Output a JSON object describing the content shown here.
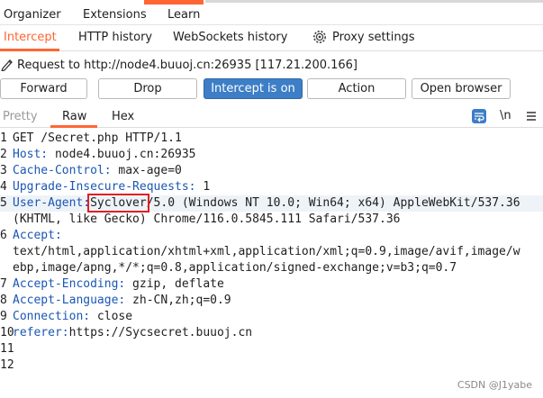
{
  "top_menu": {
    "items": [
      "Organizer",
      "Extensions",
      "Learn"
    ]
  },
  "proxy_tabs": {
    "tabs": [
      "Intercept",
      "HTTP history",
      "WebSockets history",
      "Proxy settings"
    ]
  },
  "request": {
    "text": "Request to http://node4.buuoj.cn:26935  [117.21.200.166]"
  },
  "buttons": {
    "forward": "Forward",
    "drop": "Drop",
    "intercept": "Intercept is on",
    "action": "Action",
    "open_browser": "Open browser"
  },
  "editor_tabs": {
    "tabs": [
      "Pretty",
      "Raw",
      "Hex"
    ],
    "newline_label": "\\n"
  },
  "editor": {
    "line_numbers": [
      "1",
      "2",
      "3",
      "4",
      "5",
      "",
      "6",
      "",
      "",
      "7",
      "8",
      "9",
      "10",
      "11",
      "12"
    ],
    "lines": [
      {
        "key": "GET /Secret.php HTTP/1.1",
        "val": ""
      },
      {
        "key": "Host:",
        "val": " node4.buuoj.cn:26935"
      },
      {
        "key": "Cache-Control:",
        "val": " max-age=0"
      },
      {
        "key": "Upgrade-Insecure-Requests:",
        "val": " 1"
      },
      {
        "key": "User-Agent:",
        "highlight": "Syclover",
        "val": "/5.0 (Windows NT 10.0; Win64; x64) AppleWebKit/537.36"
      },
      {
        "key": "",
        "val": "(KHTML, like Gecko) Chrome/116.0.5845.111 Safari/537.36"
      },
      {
        "key": "Accept:",
        "val": ""
      },
      {
        "key": "",
        "val": "text/html,application/xhtml+xml,application/xml;q=0.9,image/avif,image/w"
      },
      {
        "key": "",
        "val": "ebp,image/apng,*/*;q=0.8,application/signed-exchange;v=b3;q=0.7"
      },
      {
        "key": "Accept-Encoding:",
        "val": " gzip, deflate"
      },
      {
        "key": "Accept-Language:",
        "val": " zh-CN,zh;q=0.9"
      },
      {
        "key": "Connection:",
        "val": " close"
      },
      {
        "key": "referer:",
        "val": "https://Sycsecret.buuoj.cn"
      },
      {
        "key": "",
        "val": ""
      },
      {
        "key": "",
        "val": ""
      }
    ]
  },
  "watermark": "CSDN @J1yabe",
  "colors": {
    "accent": "#ff6633",
    "primary_button": "#3d7ec6",
    "header_key": "#1a57b4",
    "highlight_box": "#e02020"
  }
}
